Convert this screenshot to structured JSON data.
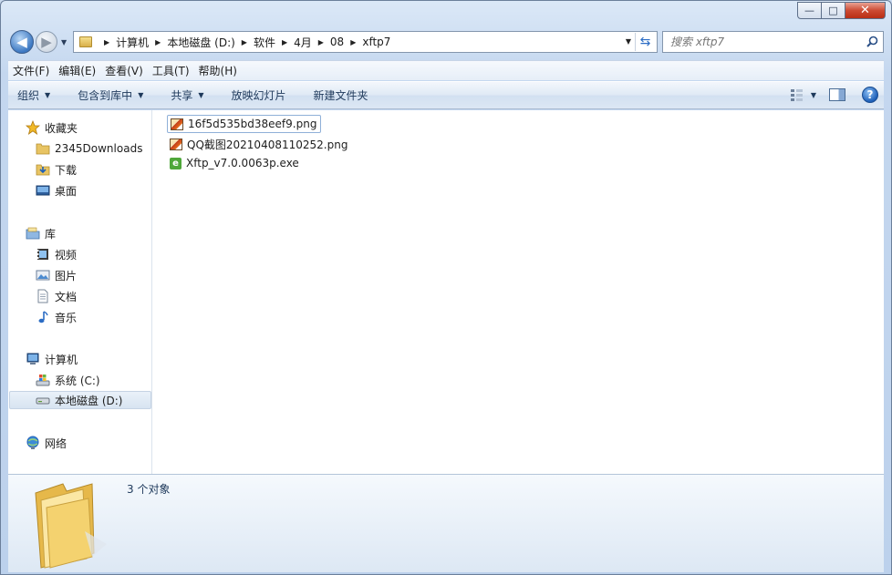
{
  "window": {
    "caption": {
      "min": "—",
      "max": "□",
      "close": "✕"
    }
  },
  "nav": {
    "back_glyph": "◀",
    "forward_glyph": "▶"
  },
  "address": {
    "crumbs": [
      "计算机",
      "本地磁盘 (D:)",
      "软件",
      "4月",
      "08",
      "xftp7"
    ]
  },
  "search": {
    "placeholder": "搜索 xftp7"
  },
  "menubar": {
    "items": [
      "文件(F)",
      "编辑(E)",
      "查看(V)",
      "工具(T)",
      "帮助(H)"
    ]
  },
  "cmdbar": {
    "organize": "组织",
    "include_in_library": "包含到库中",
    "share": "共享",
    "slideshow": "放映幻灯片",
    "new_folder": "新建文件夹"
  },
  "navpane": {
    "favorites": {
      "label": "收藏夹",
      "items": [
        "2345Downloads",
        "下载",
        "桌面"
      ]
    },
    "libraries": {
      "label": "库",
      "items": [
        "视频",
        "图片",
        "文档",
        "音乐"
      ]
    },
    "computer": {
      "label": "计算机",
      "items": [
        "系统 (C:)",
        "本地磁盘 (D:)"
      ]
    },
    "network": {
      "label": "网络"
    }
  },
  "files": [
    {
      "name": "16f5d535bd38eef9.png",
      "type": "image"
    },
    {
      "name": "QQ截图20210408110252.png",
      "type": "image"
    },
    {
      "name": "Xftp_v7.0.0063p.exe",
      "type": "exe"
    }
  ],
  "details": {
    "count": "3 个对象"
  },
  "colors": {
    "accent": "#2b6cc4",
    "close_red": "#cc4a32",
    "exe_green": "#4fa73a"
  }
}
